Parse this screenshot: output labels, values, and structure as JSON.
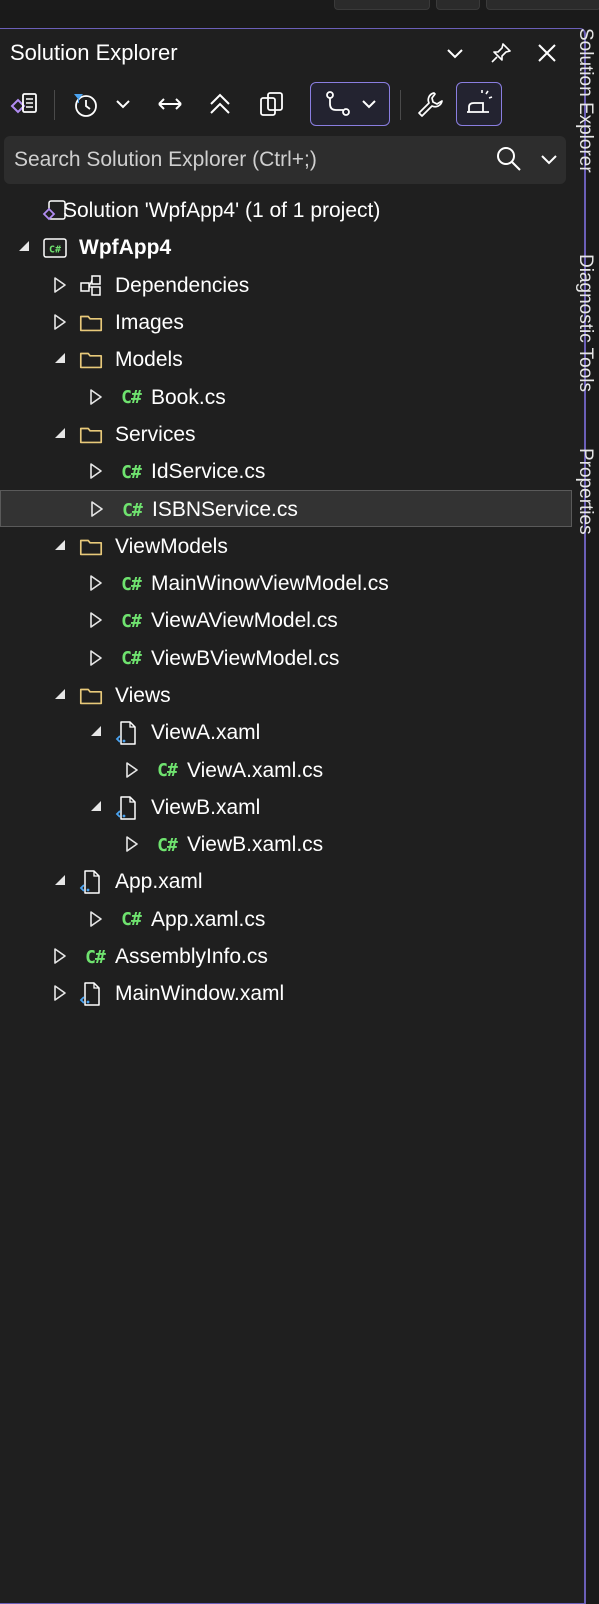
{
  "window": {
    "title": "Solution Explorer"
  },
  "vertical_tabs": [
    "Solution Explorer",
    "Diagnostic Tools",
    "Properties"
  ],
  "search": {
    "placeholder": "Search Solution Explorer (Ctrl+;)"
  },
  "colors": {
    "accent": "#8a7ee0",
    "csharp": "#6fe36f",
    "folder": "#e8c97a",
    "background": "#1f1f1f"
  },
  "tree": [
    {
      "depth": 0,
      "expander": "none",
      "icon": "solution-icon",
      "label": "Solution 'WpfApp4' (1 of 1 project)"
    },
    {
      "depth": 0,
      "expander": "expanded",
      "icon": "csharp-project-icon",
      "label": "WpfApp4",
      "bold": true
    },
    {
      "depth": 1,
      "expander": "collapsed",
      "icon": "dependencies-icon",
      "label": "Dependencies"
    },
    {
      "depth": 1,
      "expander": "collapsed",
      "icon": "folder-icon",
      "label": "Images"
    },
    {
      "depth": 1,
      "expander": "expanded",
      "icon": "folder-icon",
      "label": "Models"
    },
    {
      "depth": 2,
      "expander": "collapsed",
      "icon": "csharp-file-icon",
      "label": "Book.cs"
    },
    {
      "depth": 1,
      "expander": "expanded",
      "icon": "folder-icon",
      "label": "Services"
    },
    {
      "depth": 2,
      "expander": "collapsed",
      "icon": "csharp-file-icon",
      "label": "IdService.cs"
    },
    {
      "depth": 2,
      "expander": "collapsed",
      "icon": "csharp-file-icon",
      "label": "ISBNService.cs",
      "selected": true
    },
    {
      "depth": 1,
      "expander": "expanded",
      "icon": "folder-icon",
      "label": "ViewModels"
    },
    {
      "depth": 2,
      "expander": "collapsed",
      "icon": "csharp-file-icon",
      "label": "MainWinowViewModel.cs"
    },
    {
      "depth": 2,
      "expander": "collapsed",
      "icon": "csharp-file-icon",
      "label": "ViewAViewModel.cs"
    },
    {
      "depth": 2,
      "expander": "collapsed",
      "icon": "csharp-file-icon",
      "label": "ViewBViewModel.cs"
    },
    {
      "depth": 1,
      "expander": "expanded",
      "icon": "folder-icon",
      "label": "Views"
    },
    {
      "depth": 2,
      "expander": "expanded",
      "icon": "xaml-file-icon",
      "label": "ViewA.xaml"
    },
    {
      "depth": 3,
      "expander": "collapsed",
      "icon": "csharp-file-icon",
      "label": "ViewA.xaml.cs"
    },
    {
      "depth": 2,
      "expander": "expanded",
      "icon": "xaml-file-icon",
      "label": "ViewB.xaml"
    },
    {
      "depth": 3,
      "expander": "collapsed",
      "icon": "csharp-file-icon",
      "label": "ViewB.xaml.cs"
    },
    {
      "depth": 1,
      "expander": "expanded",
      "icon": "xaml-file-icon",
      "label": "App.xaml"
    },
    {
      "depth": 2,
      "expander": "collapsed",
      "icon": "csharp-file-icon",
      "label": "App.xaml.cs"
    },
    {
      "depth": 1,
      "expander": "collapsed",
      "icon": "csharp-file-icon",
      "label": "AssemblyInfo.cs"
    },
    {
      "depth": 1,
      "expander": "collapsed",
      "icon": "xaml-file-icon",
      "label": "MainWindow.xaml"
    }
  ]
}
